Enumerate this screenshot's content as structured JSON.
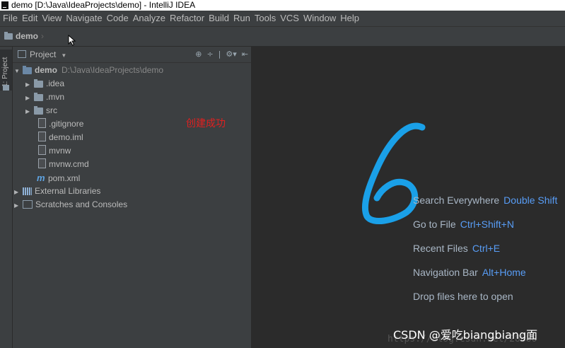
{
  "window": {
    "title": "demo [D:\\Java\\IdeaProjects\\demo] - IntelliJ IDEA"
  },
  "menu": [
    "File",
    "Edit",
    "View",
    "Navigate",
    "Code",
    "Analyze",
    "Refactor",
    "Build",
    "Run",
    "Tools",
    "VCS",
    "Window",
    "Help"
  ],
  "navbar": {
    "breadcrumb": "demo"
  },
  "left_strip": {
    "tab_label": "1: Project"
  },
  "project_panel": {
    "title": "Project",
    "tree": [
      {
        "label": "demo",
        "path": "D:\\Java\\IdeaProjects\\demo",
        "icon": "module-folder-icon",
        "arrow": "▼",
        "bold": true
      },
      {
        "label": ".idea",
        "icon": "folder-icon",
        "arrow": "▶"
      },
      {
        "label": ".mvn",
        "icon": "folder-icon",
        "arrow": "▶"
      },
      {
        "label": "src",
        "icon": "folder-icon",
        "arrow": "▶"
      },
      {
        "label": ".gitignore",
        "icon": "file-icon",
        "arrow": ""
      },
      {
        "label": "demo.iml",
        "icon": "file-icon",
        "arrow": ""
      },
      {
        "label": "mvnw",
        "icon": "file-icon",
        "arrow": ""
      },
      {
        "label": "mvnw.cmd",
        "icon": "file-icon",
        "arrow": ""
      },
      {
        "label": "pom.xml",
        "icon": "maven-icon",
        "arrow": ""
      },
      {
        "label": "External Libraries",
        "icon": "libraries-icon",
        "arrow": "▶"
      },
      {
        "label": "Scratches and Consoles",
        "icon": "scratches-icon",
        "arrow": "▶"
      }
    ]
  },
  "annotation": "创建成功",
  "editor": {
    "hints": [
      {
        "text": "Search Everywhere",
        "key": "Double Shift"
      },
      {
        "text": "Go to File",
        "key": "Ctrl+Shift+N"
      },
      {
        "text": "Recent Files",
        "key": "Ctrl+E"
      },
      {
        "text": "Navigation Bar",
        "key": "Alt+Home"
      },
      {
        "text": "Drop files here to open",
        "key": ""
      }
    ]
  },
  "watermark": {
    "text": "CSDN @爱吃biangbiang面",
    "url": "https://blog.csdn.net/28880"
  },
  "colors": {
    "accent": "#589df6",
    "annotation": "#e02020",
    "six_stroke": "#1aa0e8"
  }
}
